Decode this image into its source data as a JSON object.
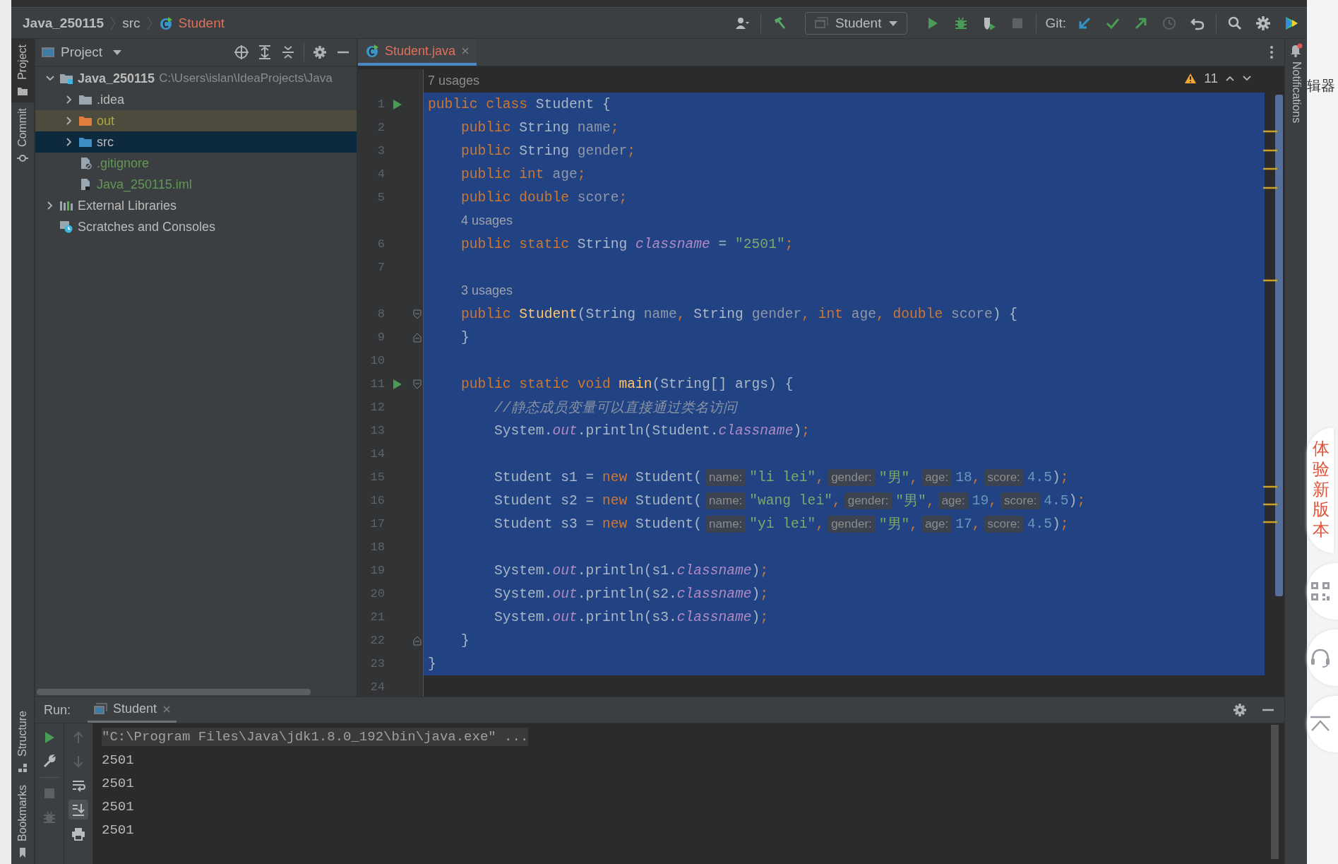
{
  "breadcrumb": [
    {
      "label": "Java_250115",
      "kind": "module"
    },
    {
      "label": "src",
      "kind": "folder"
    },
    {
      "label": "Student",
      "kind": "class"
    }
  ],
  "toolbar": {
    "items": [
      {
        "kind": "user",
        "disabled": false
      },
      {
        "kind": "separator"
      },
      {
        "kind": "build",
        "disabled": false
      },
      {
        "kind": "config",
        "label": "Student"
      },
      {
        "kind": "run",
        "disabled": false
      },
      {
        "kind": "debug",
        "disabled": false
      },
      {
        "kind": "coverage",
        "disabled": false
      },
      {
        "kind": "stop",
        "disabled": true
      },
      {
        "kind": "separator"
      },
      {
        "kind": "label",
        "label": "Git:"
      },
      {
        "kind": "update",
        "disabled": false
      },
      {
        "kind": "commit",
        "disabled": false
      },
      {
        "kind": "push",
        "disabled": false
      },
      {
        "kind": "history",
        "disabled": true
      },
      {
        "kind": "rollback",
        "disabled": false
      },
      {
        "kind": "separator"
      },
      {
        "kind": "search",
        "disabled": false
      },
      {
        "kind": "settings",
        "disabled": false
      },
      {
        "kind": "plugin"
      }
    ]
  },
  "tool_tabs_top": [
    {
      "label": "Project",
      "kind": "project",
      "selected": true
    },
    {
      "label": "Commit",
      "kind": "commit",
      "selected": false
    }
  ],
  "tool_tabs_bottom": [
    {
      "label": "Structure",
      "kind": "structure",
      "selected": false
    },
    {
      "label": "Bookmarks",
      "kind": "bookmarks",
      "selected": false
    }
  ],
  "project_panel": {
    "title": "Project",
    "tree": [
      {
        "label": "Java_250115",
        "path": "C:\\Users\\islan\\IdeaProjects\\Java",
        "kind": "module",
        "expanded": true,
        "selected": false,
        "children": [
          {
            "label": ".idea",
            "kind": "folder",
            "expanded": false,
            "selected": false
          },
          {
            "label": "out",
            "kind": "excluded-folder",
            "expanded": false,
            "selected": false
          },
          {
            "label": "src",
            "kind": "source-folder",
            "expanded": false,
            "selected": true
          },
          {
            "label": ".gitignore",
            "kind": "ignore-file",
            "selected": false
          },
          {
            "label": "Java_250115.iml",
            "kind": "iml-file",
            "selected": false
          }
        ]
      },
      {
        "label": "External Libraries",
        "kind": "libraries",
        "expanded": false,
        "selected": false
      },
      {
        "label": "Scratches and Consoles",
        "kind": "scratches",
        "selected": false
      }
    ]
  },
  "editor": {
    "tabs": [
      {
        "label": "Student.java",
        "selected": true
      }
    ],
    "warnings": "11",
    "lines": [
      {
        "kind": "usages",
        "selected": false,
        "tokens": [
          {
            "kind": "usage",
            "text": "7 usages"
          }
        ]
      },
      {
        "kind": "code",
        "number": "1",
        "run": true,
        "fold_start": false,
        "fold_end": false,
        "selected": true,
        "tokens": [
          {
            "kind": "kw",
            "text": "public class "
          },
          {
            "kind": "plain",
            "text": "Student {"
          }
        ]
      },
      {
        "kind": "code",
        "number": "2",
        "run": false,
        "fold_start": false,
        "fold_end": false,
        "selected": true,
        "tokens": [
          {
            "kind": "kw",
            "text": "    public "
          },
          {
            "kind": "plain",
            "text": "String "
          },
          {
            "kind": "field",
            "text": "name"
          },
          {
            "kind": "punct",
            "text": ";"
          }
        ]
      },
      {
        "kind": "code",
        "number": "3",
        "run": false,
        "fold_start": false,
        "fold_end": false,
        "selected": true,
        "tokens": [
          {
            "kind": "kw",
            "text": "    public "
          },
          {
            "kind": "plain",
            "text": "String "
          },
          {
            "kind": "field",
            "text": "gender"
          },
          {
            "kind": "punct",
            "text": ";"
          }
        ]
      },
      {
        "kind": "code",
        "number": "4",
        "run": false,
        "fold_start": false,
        "fold_end": false,
        "selected": true,
        "tokens": [
          {
            "kind": "kw",
            "text": "    public int "
          },
          {
            "kind": "field",
            "text": "age"
          },
          {
            "kind": "punct",
            "text": ";"
          }
        ]
      },
      {
        "kind": "code",
        "number": "5",
        "run": false,
        "fold_start": false,
        "fold_end": false,
        "selected": true,
        "tokens": [
          {
            "kind": "kw",
            "text": "    public double "
          },
          {
            "kind": "field",
            "text": "score"
          },
          {
            "kind": "punct",
            "text": ";"
          }
        ]
      },
      {
        "kind": "usages",
        "selected": true,
        "tokens": [
          {
            "kind": "usage",
            "text": "    4 usages"
          }
        ]
      },
      {
        "kind": "code",
        "number": "6",
        "run": false,
        "fold_start": false,
        "fold_end": false,
        "selected": true,
        "tokens": [
          {
            "kind": "kw",
            "text": "    public static "
          },
          {
            "kind": "plain",
            "text": "String "
          },
          {
            "kind": "static",
            "text": "classname"
          },
          {
            "kind": "plain",
            "text": " = "
          },
          {
            "kind": "str",
            "text": "\"2501\""
          },
          {
            "kind": "punct",
            "text": ";"
          }
        ]
      },
      {
        "kind": "code",
        "number": "7",
        "run": false,
        "fold_start": false,
        "fold_end": false,
        "selected": true
      },
      {
        "kind": "usages",
        "selected": true,
        "tokens": [
          {
            "kind": "usage",
            "text": "    3 usages"
          }
        ]
      },
      {
        "kind": "code",
        "number": "8",
        "run": false,
        "fold_start": true,
        "fold_end": false,
        "selected": true,
        "tokens": [
          {
            "kind": "kw",
            "text": "    public "
          },
          {
            "kind": "method",
            "text": "Student"
          },
          {
            "kind": "plain",
            "text": "(String "
          },
          {
            "kind": "field",
            "text": "name"
          },
          {
            "kind": "punct",
            "text": ", "
          },
          {
            "kind": "plain",
            "text": "String "
          },
          {
            "kind": "field",
            "text": "gender"
          },
          {
            "kind": "punct",
            "text": ", "
          },
          {
            "kind": "kw",
            "text": "int "
          },
          {
            "kind": "field",
            "text": "age"
          },
          {
            "kind": "punct",
            "text": ", "
          },
          {
            "kind": "kw",
            "text": "double "
          },
          {
            "kind": "field",
            "text": "score"
          },
          {
            "kind": "plain",
            "text": ") {"
          }
        ]
      },
      {
        "kind": "code",
        "number": "9",
        "run": false,
        "fold_start": false,
        "fold_end": true,
        "selected": true,
        "tokens": [
          {
            "kind": "plain",
            "text": "    }"
          }
        ]
      },
      {
        "kind": "code",
        "number": "10",
        "run": false,
        "fold_start": false,
        "fold_end": false,
        "selected": true
      },
      {
        "kind": "code",
        "number": "11",
        "run": true,
        "fold_start": true,
        "fold_end": false,
        "selected": true,
        "tokens": [
          {
            "kind": "kw",
            "text": "    public static void "
          },
          {
            "kind": "method",
            "text": "main"
          },
          {
            "kind": "plain",
            "text": "(String[] args) {"
          }
        ]
      },
      {
        "kind": "code",
        "number": "12",
        "run": false,
        "fold_start": false,
        "fold_end": false,
        "selected": true,
        "tokens": [
          {
            "kind": "comment",
            "text": "        //静态成员变量可以直接通过类名访问"
          }
        ]
      },
      {
        "kind": "code",
        "number": "13",
        "run": false,
        "fold_start": false,
        "fold_end": false,
        "selected": true,
        "tokens": [
          {
            "kind": "plain",
            "text": "        System."
          },
          {
            "kind": "static",
            "text": "out"
          },
          {
            "kind": "plain",
            "text": ".println(Student."
          },
          {
            "kind": "static",
            "text": "classname"
          },
          {
            "kind": "plain",
            "text": ")"
          },
          {
            "kind": "punct",
            "text": ";"
          }
        ]
      },
      {
        "kind": "code",
        "number": "14",
        "run": false,
        "fold_start": false,
        "fold_end": false,
        "selected": true
      },
      {
        "kind": "code",
        "number": "15",
        "run": false,
        "fold_start": false,
        "fold_end": false,
        "selected": true,
        "tokens": [
          {
            "kind": "plain",
            "text": "        Student s1 = "
          },
          {
            "kind": "kw",
            "text": "new "
          },
          {
            "kind": "plain",
            "text": "Student("
          },
          {
            "kind": "hint",
            "text": "name:"
          },
          {
            "kind": "str",
            "text": "\"li lei\""
          },
          {
            "kind": "punct",
            "text": ","
          },
          {
            "kind": "hint",
            "text": "gender:"
          },
          {
            "kind": "str",
            "text": "\"男\""
          },
          {
            "kind": "punct",
            "text": ","
          },
          {
            "kind": "hint",
            "text": "age:"
          },
          {
            "kind": "num",
            "text": "18"
          },
          {
            "kind": "punct",
            "text": ","
          },
          {
            "kind": "hint",
            "text": "score:"
          },
          {
            "kind": "num",
            "text": "4.5"
          },
          {
            "kind": "plain",
            "text": ")"
          },
          {
            "kind": "punct",
            "text": ";"
          }
        ]
      },
      {
        "kind": "code",
        "number": "16",
        "run": false,
        "fold_start": false,
        "fold_end": false,
        "selected": true,
        "tokens": [
          {
            "kind": "plain",
            "text": "        Student s2 = "
          },
          {
            "kind": "kw",
            "text": "new "
          },
          {
            "kind": "plain",
            "text": "Student("
          },
          {
            "kind": "hint",
            "text": "name:"
          },
          {
            "kind": "str",
            "text": "\"wang lei\""
          },
          {
            "kind": "punct",
            "text": ","
          },
          {
            "kind": "hint",
            "text": "gender:"
          },
          {
            "kind": "str",
            "text": "\"男\""
          },
          {
            "kind": "punct",
            "text": ","
          },
          {
            "kind": "hint",
            "text": "age:"
          },
          {
            "kind": "num",
            "text": "19"
          },
          {
            "kind": "punct",
            "text": ","
          },
          {
            "kind": "hint",
            "text": "score:"
          },
          {
            "kind": "num",
            "text": "4.5"
          },
          {
            "kind": "plain",
            "text": ")"
          },
          {
            "kind": "punct",
            "text": ";"
          }
        ]
      },
      {
        "kind": "code",
        "number": "17",
        "run": false,
        "fold_start": false,
        "fold_end": false,
        "selected": true,
        "tokens": [
          {
            "kind": "plain",
            "text": "        Student s3 = "
          },
          {
            "kind": "kw",
            "text": "new "
          },
          {
            "kind": "plain",
            "text": "Student("
          },
          {
            "kind": "hint",
            "text": "name:"
          },
          {
            "kind": "str",
            "text": "\"yi lei\""
          },
          {
            "kind": "punct",
            "text": ","
          },
          {
            "kind": "hint",
            "text": "gender:"
          },
          {
            "kind": "str",
            "text": "\"男\""
          },
          {
            "kind": "punct",
            "text": ","
          },
          {
            "kind": "hint",
            "text": "age:"
          },
          {
            "kind": "num",
            "text": "17"
          },
          {
            "kind": "punct",
            "text": ","
          },
          {
            "kind": "hint",
            "text": "score:"
          },
          {
            "kind": "num",
            "text": "4.5"
          },
          {
            "kind": "plain",
            "text": ")"
          },
          {
            "kind": "punct",
            "text": ";"
          }
        ]
      },
      {
        "kind": "code",
        "number": "18",
        "run": false,
        "fold_start": false,
        "fold_end": false,
        "selected": true
      },
      {
        "kind": "code",
        "number": "19",
        "run": false,
        "fold_start": false,
        "fold_end": false,
        "selected": true,
        "tokens": [
          {
            "kind": "plain",
            "text": "        System."
          },
          {
            "kind": "static",
            "text": "out"
          },
          {
            "kind": "plain",
            "text": ".println(s1."
          },
          {
            "kind": "static",
            "text": "classname"
          },
          {
            "kind": "plain",
            "text": ")"
          },
          {
            "kind": "punct",
            "text": ";"
          }
        ]
      },
      {
        "kind": "code",
        "number": "20",
        "run": false,
        "fold_start": false,
        "fold_end": false,
        "selected": true,
        "tokens": [
          {
            "kind": "plain",
            "text": "        System."
          },
          {
            "kind": "static",
            "text": "out"
          },
          {
            "kind": "plain",
            "text": ".println(s2."
          },
          {
            "kind": "static",
            "text": "classname"
          },
          {
            "kind": "plain",
            "text": ")"
          },
          {
            "kind": "punct",
            "text": ";"
          }
        ]
      },
      {
        "kind": "code",
        "number": "21",
        "run": false,
        "fold_start": false,
        "fold_end": false,
        "selected": true,
        "tokens": [
          {
            "kind": "plain",
            "text": "        System."
          },
          {
            "kind": "static",
            "text": "out"
          },
          {
            "kind": "plain",
            "text": ".println(s3."
          },
          {
            "kind": "static",
            "text": "classname"
          },
          {
            "kind": "plain",
            "text": ")"
          },
          {
            "kind": "punct",
            "text": ";"
          }
        ]
      },
      {
        "kind": "code",
        "number": "22",
        "run": false,
        "fold_start": false,
        "fold_end": true,
        "selected": true,
        "tokens": [
          {
            "kind": "plain",
            "text": "    }"
          }
        ]
      },
      {
        "kind": "code",
        "number": "23",
        "run": false,
        "fold_start": false,
        "fold_end": false,
        "selected": true,
        "tokens": [
          {
            "kind": "plain",
            "text": "}"
          }
        ]
      },
      {
        "kind": "code",
        "number": "24",
        "run": false,
        "fold_start": false,
        "fold_end": false,
        "selected": false
      }
    ]
  },
  "notifications": {
    "label": "Notifications",
    "unread": true
  },
  "run_panel": {
    "label": "Run:",
    "tabs": [
      {
        "label": "Student",
        "selected": true
      }
    ],
    "tools_left": [
      {
        "kind": "run",
        "disabled": false
      },
      {
        "kind": "wrench",
        "disabled": false
      },
      {
        "kind": "stop",
        "disabled": true
      },
      {
        "kind": "debug",
        "disabled": true
      }
    ],
    "tools_right": [
      {
        "kind": "up",
        "disabled": true,
        "on": false
      },
      {
        "kind": "down",
        "disabled": true,
        "on": false
      },
      {
        "kind": "wrap",
        "disabled": false,
        "on": false
      },
      {
        "kind": "scroll-end",
        "disabled": false,
        "on": true
      },
      {
        "kind": "print",
        "disabled": false,
        "on": false
      }
    ],
    "console": [
      {
        "kind": "command",
        "text": "\"C:\\Program Files\\Java\\jdk1.8.0_192\\bin\\java.exe\" ..."
      },
      {
        "kind": "output",
        "text": "2501"
      },
      {
        "kind": "output",
        "text": "2501"
      },
      {
        "kind": "output",
        "text": "2501"
      },
      {
        "kind": "output",
        "text": "2501"
      }
    ]
  },
  "browser": {
    "title_fragment": "辑器",
    "promo": "体验新版本"
  }
}
